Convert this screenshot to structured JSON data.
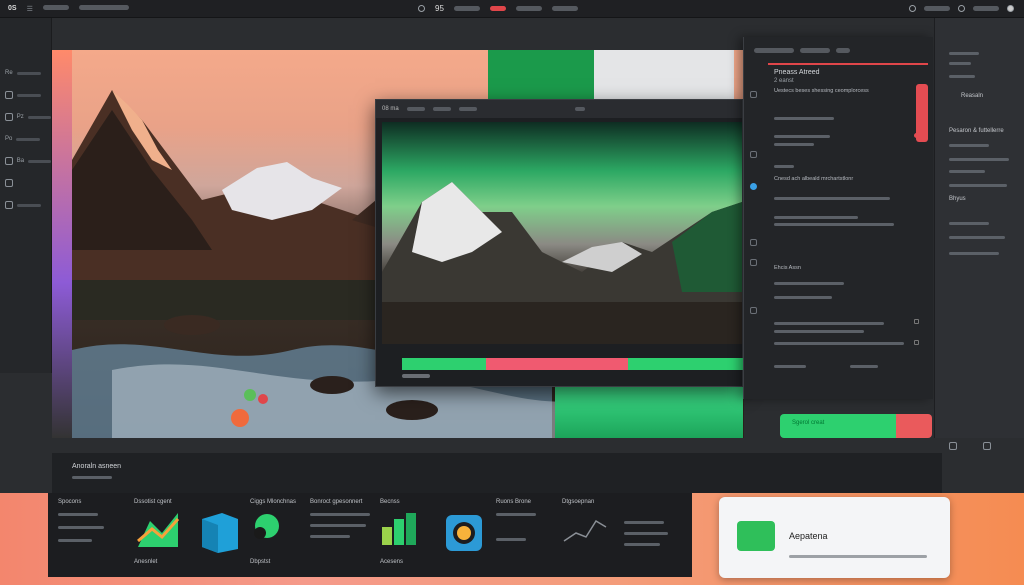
{
  "topbar": {
    "app_label": "0S",
    "center_label": "95"
  },
  "leftbar": {
    "items": [
      "Re",
      "Pl",
      "Pz",
      "Po",
      "Ba"
    ]
  },
  "inner_window": {
    "title": "08 ma"
  },
  "panel_mid": {
    "title": "Pneass Atreed",
    "subtitle": "2 eanst",
    "rows": [
      "Uestecs beses shessing ceomplorcess",
      "Cnesd ach albeald mrchartstlonr",
      "Ehcis Assn"
    ],
    "button_label": "Sgerol creat"
  },
  "panel_right": {
    "title": "Reasaln",
    "heading": "Pesaron & futtellerre",
    "item_label": "Bhyus"
  },
  "bottom": {
    "section_title": "Anoraln asneen",
    "tiles": [
      {
        "title": "Spocons",
        "caption": ""
      },
      {
        "title": "Dssotist cgent",
        "caption": "Anesnlet"
      },
      {
        "title": "",
        "caption": ""
      },
      {
        "title": "Ciggs Mlonchnas",
        "caption": "Dbpstst"
      },
      {
        "title": "Bonroct gpesonnert",
        "caption": ""
      },
      {
        "title": "Becnss",
        "caption": "Acesens"
      },
      {
        "title": "",
        "caption": ""
      },
      {
        "title": "Ruons Brone",
        "caption": ""
      },
      {
        "title": "Dtgsoepnan",
        "caption": ""
      }
    ]
  },
  "card": {
    "title": "Aepatena"
  },
  "colors": {
    "accent_green": "#2dd06f",
    "accent_red": "#e44c52",
    "bottom_gradient_start": "#f3866d",
    "bottom_gradient_end": "#f58c52"
  }
}
